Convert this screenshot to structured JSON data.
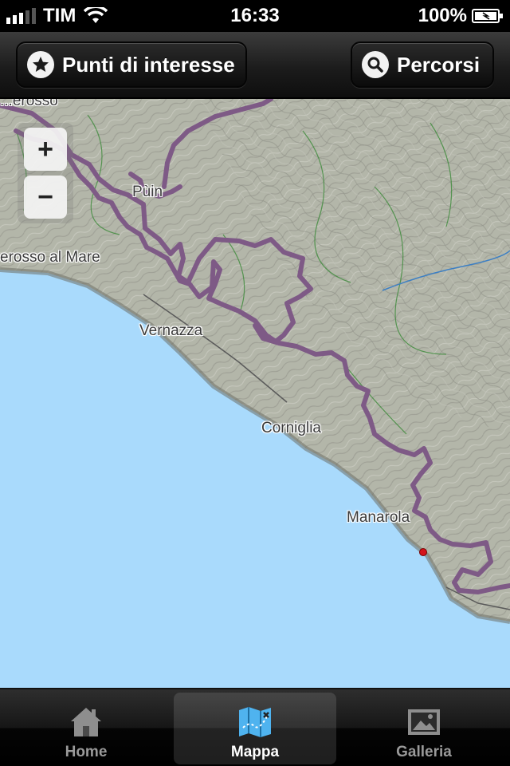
{
  "status_bar": {
    "carrier": "TIM",
    "time": "16:33",
    "battery": "100%",
    "signal_bars_active": 3,
    "signal_bars_total": 5
  },
  "toolbar": {
    "poi_label": "Punti di interesse",
    "poi_icon": "star-icon",
    "routes_label": "Percorsi",
    "routes_icon": "search-icon"
  },
  "map": {
    "zoom_in": "+",
    "zoom_out": "−",
    "labels": {
      "top_partial": "...erosso",
      "puin": "Pùin",
      "monterosso": "erosso al Mare",
      "vernazza": "Vernazza",
      "corniglia": "Corniglia",
      "manarola": "Manarola"
    },
    "colors": {
      "sea": "#a9dafc",
      "land": "#a8ab9e",
      "trail": "#7e5a86",
      "poi_marker": "#d4141c"
    }
  },
  "tabbar": {
    "tabs": [
      {
        "label": "Home",
        "icon": "house-icon"
      },
      {
        "label": "Mappa",
        "icon": "map-icon",
        "selected": true
      },
      {
        "label": "Galleria",
        "icon": "picture-icon"
      }
    ]
  }
}
